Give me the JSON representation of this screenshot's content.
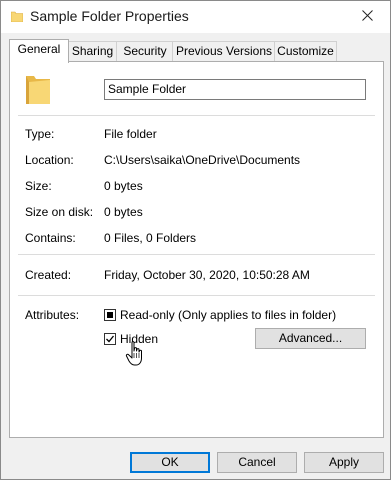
{
  "window": {
    "title": "Sample Folder Properties"
  },
  "tabs": [
    {
      "label": "General",
      "active": true
    },
    {
      "label": "Sharing"
    },
    {
      "label": "Security"
    },
    {
      "label": "Previous Versions"
    },
    {
      "label": "Customize"
    }
  ],
  "general": {
    "folder_name": "Sample Folder",
    "type": {
      "label": "Type:",
      "value": "File folder"
    },
    "location": {
      "label": "Location:",
      "value": "C:\\Users\\saika\\OneDrive\\Documents"
    },
    "size": {
      "label": "Size:",
      "value": "0 bytes"
    },
    "size_on_disk": {
      "label": "Size on disk:",
      "value": "0 bytes"
    },
    "contains": {
      "label": "Contains:",
      "value": "0 Files, 0 Folders"
    },
    "created": {
      "label": "Created:",
      "value": "Friday, October 30, 2020, 10:50:28 AM"
    },
    "attributes": {
      "label": "Attributes:",
      "readonly": {
        "label": "Read-only (Only applies to files in folder)",
        "state": "indeterminate"
      },
      "hidden": {
        "label": "Hidden",
        "state": "checked"
      },
      "advanced_label": "Advanced..."
    }
  },
  "footer": {
    "ok": "OK",
    "cancel": "Cancel",
    "apply": "Apply"
  },
  "colors": {
    "accent": "#0078d7",
    "folder": "#f8d775",
    "folder_dark": "#e8b848"
  },
  "icons": {
    "title": "folder-icon",
    "close": "close-icon",
    "large": "folder-large-icon",
    "cursor": "hand-pointer-cursor"
  }
}
